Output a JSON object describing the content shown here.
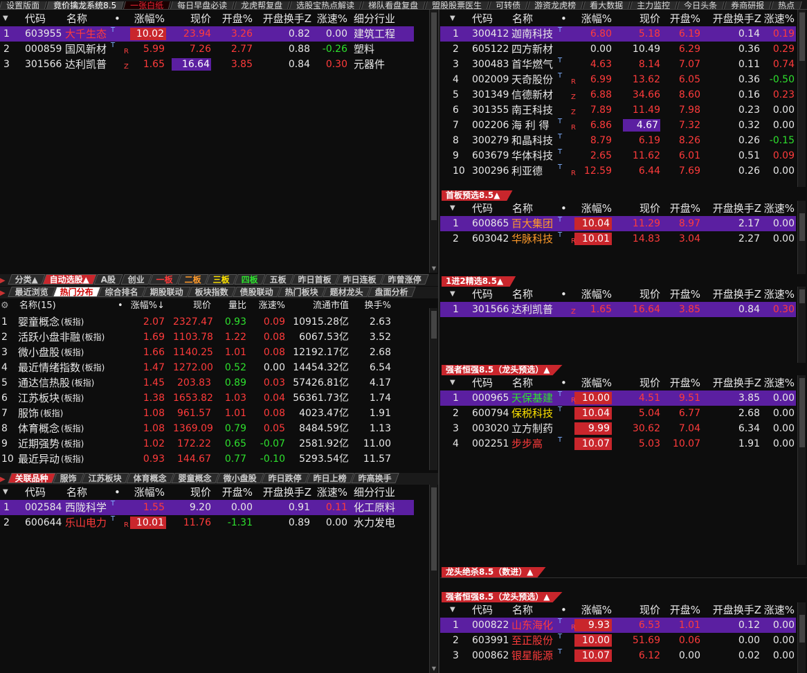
{
  "top_tabs": [
    "设置版面",
    "竟价擒龙系统8.5",
    "一张白纸",
    "每日早盘必读",
    "龙虎帮复盘",
    "选股宝热点解读",
    "梯队看盘复盘",
    "盟股股票医生",
    "可转债",
    "游资龙虎榜",
    "看大数据",
    "主力监控",
    "今日头条",
    "券商研报",
    "热点"
  ],
  "main_table": {
    "headers": [
      "代码",
      "名称",
      "•",
      "涨幅%",
      "现价",
      "开盘%",
      "开盘换手Z",
      "涨速%",
      "细分行业"
    ],
    "rows": [
      {
        "idx": "1",
        "code": "603955",
        "name": "大千生态",
        "tag": "T",
        "chg": "10.02",
        "price": "23.94",
        "open": "3.26",
        "turn": "0.82",
        "speed": "0.00",
        "ind": "建筑工程"
      },
      {
        "idx": "2",
        "code": "000859",
        "name": "国风新材",
        "tag": "T",
        "chg": "5.99",
        "price": "7.26",
        "open": "2.77",
        "turn": "0.88",
        "speed": "-0.26",
        "ind": "塑料",
        "rz": "R"
      },
      {
        "idx": "3",
        "code": "301566",
        "name": "达利凯普",
        "tag": "",
        "chg": "1.65",
        "price": "16.64",
        "open": "3.85",
        "turn": "0.84",
        "speed": "0.30",
        "ind": "元器件",
        "rz": "Z"
      }
    ]
  },
  "right_table1": {
    "headers": [
      "代码",
      "名称",
      "•",
      "涨幅%",
      "现价",
      "开盘%",
      "开盘换手Z",
      "涨速%"
    ],
    "rows": [
      {
        "idx": "1",
        "code": "300412",
        "name": "迦南科技",
        "tag": "T",
        "rz": "",
        "chg": "6.80",
        "price": "5.18",
        "open": "6.19",
        "turn": "0.14",
        "speed": "0.19"
      },
      {
        "idx": "2",
        "code": "605122",
        "name": "四方新材",
        "tag": "",
        "rz": "",
        "chg": "0.00",
        "price": "10.49",
        "open": "6.29",
        "turn": "0.36",
        "speed": "0.29"
      },
      {
        "idx": "3",
        "code": "300483",
        "name": "首华燃气",
        "tag": "T",
        "rz": "",
        "chg": "4.63",
        "price": "8.14",
        "open": "7.07",
        "turn": "0.11",
        "speed": "0.74"
      },
      {
        "idx": "4",
        "code": "002009",
        "name": "天奇股份",
        "tag": "T",
        "rz": "R",
        "chg": "6.99",
        "price": "13.62",
        "open": "6.05",
        "turn": "0.36",
        "speed": "-0.50"
      },
      {
        "idx": "5",
        "code": "301349",
        "name": "信德新材",
        "tag": "",
        "rz": "Z",
        "chg": "6.88",
        "price": "34.66",
        "open": "8.60",
        "turn": "0.16",
        "speed": "0.23"
      },
      {
        "idx": "6",
        "code": "301355",
        "name": "南王科技",
        "tag": "",
        "rz": "Z",
        "chg": "7.89",
        "price": "11.49",
        "open": "7.98",
        "turn": "0.23",
        "speed": "0.00"
      },
      {
        "idx": "7",
        "code": "002206",
        "name": "海 利 得",
        "tag": "T",
        "rz": "R",
        "chg": "6.86",
        "price": "4.67",
        "open": "7.32",
        "turn": "0.32",
        "speed": "0.00"
      },
      {
        "idx": "8",
        "code": "300279",
        "name": "和晶科技",
        "tag": "T",
        "rz": "",
        "chg": "8.79",
        "price": "6.19",
        "open": "8.26",
        "turn": "0.26",
        "speed": "-0.15"
      },
      {
        "idx": "9",
        "code": "603679",
        "name": "华体科技",
        "tag": "T",
        "rz": "",
        "chg": "2.65",
        "price": "11.62",
        "open": "6.01",
        "turn": "0.51",
        "speed": "0.09"
      },
      {
        "idx": "10",
        "code": "300296",
        "name": "利亚德",
        "tag": "T",
        "rz": "R",
        "chg": "12.59",
        "price": "6.44",
        "open": "7.69",
        "turn": "0.26",
        "speed": "0.00"
      }
    ]
  },
  "panel_titles": {
    "p1": "首板预选8.5▲",
    "p2": "1进2精选8.5▲",
    "p3": "强者恒强8.5（龙头预选）▲",
    "p4": "龙头绝杀8.5（数进）▲",
    "p5": "强者恒强8.5（龙头预选）▲"
  },
  "p1_rows": [
    {
      "idx": "1",
      "code": "600865",
      "name": "百大集团",
      "tag": "T",
      "rz": "",
      "chg": "10.04",
      "price": "11.29",
      "open": "8.97",
      "turn": "2.17",
      "speed": "0.00"
    },
    {
      "idx": "2",
      "code": "603042",
      "name": "华脉科技",
      "tag": "T",
      "rz": "R",
      "chg": "10.01",
      "price": "14.83",
      "open": "3.04",
      "turn": "2.27",
      "speed": "0.00"
    }
  ],
  "p2_rows": [
    {
      "idx": "1",
      "code": "301566",
      "name": "达利凯普",
      "tag": "",
      "rz": "Z",
      "chg": "1.65",
      "price": "16.64",
      "open": "3.85",
      "turn": "0.84",
      "speed": "0.30"
    }
  ],
  "p3_rows": [
    {
      "idx": "1",
      "code": "000965",
      "name": "天保基建",
      "tag": "T",
      "rz": "R",
      "chg": "10.00",
      "price": "4.51",
      "open": "9.51",
      "turn": "3.85",
      "speed": "0.00"
    },
    {
      "idx": "2",
      "code": "600794",
      "name": "保税科技",
      "tag": "T",
      "rz": "",
      "chg": "10.04",
      "price": "5.04",
      "open": "6.77",
      "turn": "2.68",
      "speed": "0.00"
    },
    {
      "idx": "3",
      "code": "003020",
      "name": "立方制药",
      "tag": "",
      "rz": "",
      "chg": "9.99",
      "price": "30.62",
      "open": "7.04",
      "turn": "6.34",
      "speed": "0.00"
    },
    {
      "idx": "4",
      "code": "002251",
      "name": "步步高",
      "tag": "T",
      "rz": "",
      "chg": "10.07",
      "price": "5.03",
      "open": "10.07",
      "turn": "1.91",
      "speed": "0.00"
    }
  ],
  "p5_rows": [
    {
      "idx": "1",
      "code": "000822",
      "name": "山东海化",
      "tag": "T",
      "rz": "R",
      "chg": "9.93",
      "price": "6.53",
      "open": "1.01",
      "turn": "0.12",
      "speed": "0.00"
    },
    {
      "idx": "2",
      "code": "603991",
      "name": "至正股份",
      "tag": "T",
      "rz": "",
      "chg": "10.00",
      "price": "51.69",
      "open": "0.06",
      "turn": "0.00",
      "speed": "0.00"
    },
    {
      "idx": "3",
      "code": "000862",
      "name": "银星能源",
      "tag": "T",
      "rz": "",
      "chg": "10.07",
      "price": "6.12",
      "open": "0.00",
      "turn": "0.02",
      "speed": "0.00"
    }
  ],
  "sector_tabs_row1": [
    "分类▲",
    "自动选股▲",
    "A股",
    "创业",
    "一板",
    "二板",
    "三板",
    "四板",
    "五板",
    "昨日首板",
    "昨日连板",
    "昨曾涨停"
  ],
  "sector_tabs_row2": [
    "最近浏览",
    "热门分布",
    "综合排名",
    "期股联动",
    "板块指数",
    "债股联动",
    "热门板块",
    "题材龙头",
    "盘面分析"
  ],
  "sector_table": {
    "headers": [
      "名称(15)",
      "•",
      "涨幅%↓",
      "现价",
      "量比",
      "涨速%",
      "流通市值",
      "换手%"
    ],
    "rows": [
      {
        "idx": "1",
        "name": "婴童概念",
        "suffix": "(板指)",
        "chg": "2.07",
        "price": "2327.47",
        "vr": "0.93",
        "speed": "0.09",
        "cap": "10915.28亿",
        "turn": "2.63"
      },
      {
        "idx": "2",
        "name": "活跃小盘非融",
        "suffix": "(板指)",
        "chg": "1.69",
        "price": "1103.78",
        "vr": "1.22",
        "speed": "0.08",
        "cap": "6067.53亿",
        "turn": "3.52"
      },
      {
        "idx": "3",
        "name": "微小盘股",
        "suffix": "(板指)",
        "chg": "1.66",
        "price": "1140.25",
        "vr": "1.01",
        "speed": "0.08",
        "cap": "12192.17亿",
        "turn": "2.68"
      },
      {
        "idx": "4",
        "name": "最近情绪指数",
        "suffix": "(板指)",
        "chg": "1.47",
        "price": "1272.00",
        "vr": "0.52",
        "speed": "0.00",
        "cap": "14454.32亿",
        "turn": "6.54"
      },
      {
        "idx": "5",
        "name": "通达信热股",
        "suffix": "(板指)",
        "chg": "1.45",
        "price": "203.83",
        "vr": "0.89",
        "speed": "0.03",
        "cap": "57426.81亿",
        "turn": "4.17"
      },
      {
        "idx": "6",
        "name": "江苏板块",
        "suffix": "(板指)",
        "chg": "1.38",
        "price": "1653.82",
        "vr": "1.03",
        "speed": "0.04",
        "cap": "56361.73亿",
        "turn": "1.74"
      },
      {
        "idx": "7",
        "name": "服饰",
        "suffix": "(板指)",
        "chg": "1.08",
        "price": "961.57",
        "vr": "1.01",
        "speed": "0.08",
        "cap": "4023.47亿",
        "turn": "1.91"
      },
      {
        "idx": "8",
        "name": "体育概念",
        "suffix": "(板指)",
        "chg": "1.08",
        "price": "1369.09",
        "vr": "0.79",
        "speed": "0.05",
        "cap": "8484.59亿",
        "turn": "1.13"
      },
      {
        "idx": "9",
        "name": "近期强势",
        "suffix": "(板指)",
        "chg": "1.02",
        "price": "172.22",
        "vr": "0.65",
        "speed": "-0.07",
        "cap": "2581.92亿",
        "turn": "11.00"
      },
      {
        "idx": "10",
        "name": "最近异动",
        "suffix": "(板指)",
        "chg": "0.93",
        "price": "144.67",
        "vr": "0.77",
        "speed": "-0.10",
        "cap": "5293.54亿",
        "turn": "11.57"
      }
    ]
  },
  "related_tabs": [
    "关联品种",
    "服饰",
    "江苏板块",
    "体育概念",
    "婴童概念",
    "微小盘股",
    "昨日跌停",
    "昨日上榜",
    "昨高换手"
  ],
  "related_table": {
    "rows": [
      {
        "idx": "1",
        "code": "002584",
        "name": "西陇科学",
        "tag": "T",
        "rz": "",
        "chg": "1.55",
        "price": "9.20",
        "open": "0.00",
        "turn": "0.91",
        "speed": "0.11",
        "ind": "化工原料"
      },
      {
        "idx": "2",
        "code": "600644",
        "name": "乐山电力",
        "tag": "T",
        "rz": "R",
        "chg": "10.01",
        "price": "11.76",
        "open": "-1.31",
        "turn": "0.89",
        "speed": "0.00",
        "ind": "水力发电"
      }
    ]
  },
  "colors": {
    "red": "#ff3b3b",
    "green": "#2ee02e",
    "purple": "#5b1fa1",
    "redbox": "#c9262c"
  }
}
